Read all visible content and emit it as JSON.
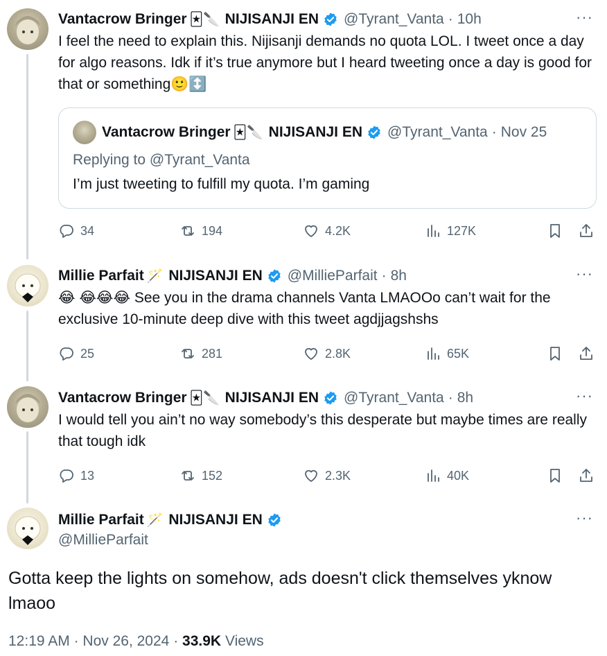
{
  "posts": [
    {
      "name": "Vantacrow Bringer",
      "emoji": "🃏🔪",
      "org": "NIJISANJI EN",
      "handle": "@Tyrant_Vanta",
      "time": "10h",
      "text": "I feel the need to explain this. Nijisanji demands no quota LOL. I tweet once a day for algo reasons. Idk if it’s true anymore but I heard tweeting once a day is good for that or something🙂↕️",
      "quote": {
        "name": "Vantacrow Bringer",
        "emoji": "🃏🔪",
        "org": "NIJISANJI EN",
        "handle": "@Tyrant_Vanta",
        "time": "Nov 25",
        "replying": "Replying to @Tyrant_Vanta",
        "text": "I’m just tweeting to fulfill my quota. I’m gaming"
      },
      "stats": {
        "replies": "34",
        "reposts": "194",
        "likes": "4.2K",
        "views": "127K"
      }
    },
    {
      "name": "Millie Parfait",
      "emoji": "🪄",
      "org": "NIJISANJI EN",
      "handle": "@MillieParfait",
      "time": "8h",
      "text": "😂 😂😂😂 See you in the drama channels Vanta LMAOOo can’t wait for the exclusive 10-minute deep dive with this tweet agdjjagshshs",
      "stats": {
        "replies": "25",
        "reposts": "281",
        "likes": "2.8K",
        "views": "65K"
      }
    },
    {
      "name": "Vantacrow Bringer",
      "emoji": "🃏🔪",
      "org": "NIJISANJI EN",
      "handle": "@Tyrant_Vanta",
      "time": "8h",
      "text": "I would tell you ain’t no way somebody’s this desperate but maybe times are really that tough idk",
      "stats": {
        "replies": "13",
        "reposts": "152",
        "likes": "2.3K",
        "views": "40K"
      }
    }
  ],
  "main": {
    "name": "Millie Parfait",
    "emoji": "🪄",
    "org": "NIJISANJI EN",
    "handle": "@MillieParfait",
    "text": "Gotta keep the lights on somehow, ads doesn't click themselves yknow lmaoo",
    "time": "12:19 AM",
    "date": "Nov 26, 2024",
    "views_count": "33.9K",
    "views_label": "Views"
  },
  "ui": {
    "more": "···",
    "dot": "·"
  },
  "colors": {
    "verified": "#1d9bf0",
    "muted": "#536471",
    "line": "#cfd9de"
  }
}
